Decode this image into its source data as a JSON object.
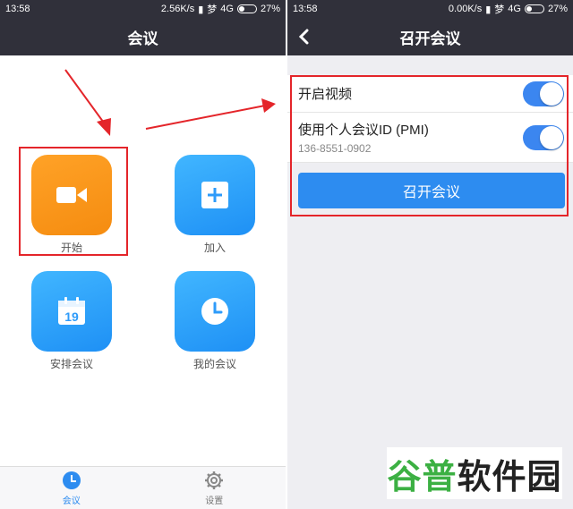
{
  "left_screen": {
    "status": {
      "time": "13:58",
      "speed": "2.56K/s",
      "network": "4G",
      "carrier_icon": "梦",
      "battery": "27%"
    },
    "title": "会议",
    "tiles": [
      {
        "label": "开始",
        "icon": "video-camera-icon",
        "color": "#f7961a"
      },
      {
        "label": "加入",
        "icon": "plus-icon",
        "color": "#2e9bfa"
      },
      {
        "label": "安排会议",
        "icon": "calendar-icon",
        "calendar_day": "19",
        "color": "#2e9bfa"
      },
      {
        "label": "我的会议",
        "icon": "clock-icon",
        "color": "#2e9bfa"
      }
    ],
    "tabs": [
      {
        "label": "会议",
        "icon": "clock-icon",
        "active": true
      },
      {
        "label": "设置",
        "icon": "gear-icon",
        "active": false
      }
    ]
  },
  "right_screen": {
    "status": {
      "time": "13:58",
      "speed": "0.00K/s",
      "network": "4G",
      "carrier_icon": "梦",
      "battery": "27%"
    },
    "title": "召开会议",
    "settings": [
      {
        "label": "开启视频",
        "toggle_on": true
      },
      {
        "label": "使用个人会议ID (PMI)",
        "sublabel": "136-8551-0902",
        "toggle_on": true
      }
    ],
    "start_button": "召开会议"
  },
  "watermark": {
    "part1": "谷普",
    "part2": "软件园"
  },
  "colors": {
    "accent": "#2d8cf0",
    "nav": "#30303a",
    "annotation": "#e4252a"
  }
}
